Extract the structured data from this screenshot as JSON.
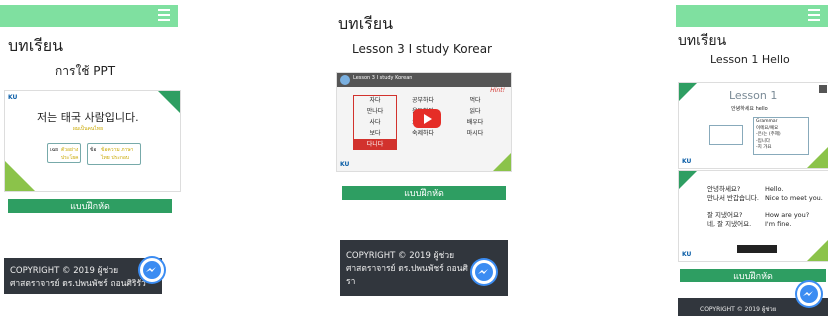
{
  "panel1": {
    "heading": "บทเรียน",
    "subtitle": "การใช้ PPT",
    "slide_title": "저는 태국 사람입니다.",
    "slide_subtitle": "ผมเป็นคนไทย",
    "box1_label": "เฉย",
    "box1_text": "ตัวอย่าง ประโยค",
    "box2_label": "ข้อ",
    "box2_text": "ข้อความ ภาษาไทย ประกอบ",
    "button": "แบบฝึกหัด",
    "footer_line1": "COPYRIGHT © 2019 ผู้ช่วย",
    "footer_line2": "ศาสตราจารย์ ดร.ปพนพัชร์ ถอนศิริรัว"
  },
  "panel2": {
    "heading": "บทเรียน",
    "subtitle": "Lesson 3 I study Korear",
    "video_title": "Lesson 3 I study Korean",
    "table_rows": [
      [
        "자다",
        "공부하다",
        "먹다"
      ],
      [
        "만나다",
        "운동하다",
        "읽다"
      ],
      [
        "사다",
        "요리하다",
        "배우다"
      ],
      [
        "보다",
        "숙제하다",
        "마시다"
      ],
      [
        "다니다",
        "",
        ""
      ]
    ],
    "hint": "Hint!",
    "button": "แบบฝึกหัด",
    "footer_line1": "COPYRIGHT © 2019 ผู้ช่วย",
    "footer_line2": "ศาสตราจารย์ ดร.ปพนพัชร์ ถอนศิ",
    "footer_line3": "รา"
  },
  "panel3": {
    "heading": "บทเรียน",
    "subtitle": "Lesson 1 Hello",
    "slide_title": "Lesson 1",
    "slide_subtitle": "안녕하세요 hello",
    "grammar_items": [
      "Grammar",
      "이에요/예요",
      "-은/는 (주제)",
      "-입니다",
      "-지 가요"
    ],
    "dialogue": [
      [
        "안녕하세요?",
        "Hello."
      ],
      [
        "만나서 반갑습니다.",
        "Nice to meet you."
      ],
      [
        "잘 지냈어요?",
        "How are you?"
      ],
      [
        "네, 잘 지냈어요.",
        "I'm fine."
      ]
    ],
    "button": "แบบฝึกหัด",
    "footer_line1": "COPYRIGHT © 2019 ผู้ช่วย"
  },
  "colors": {
    "topbar": "#7fe0a0",
    "button": "#2e9e62",
    "footer": "#31363d",
    "messenger": "#3b8cf2",
    "play": "#e52d27"
  }
}
